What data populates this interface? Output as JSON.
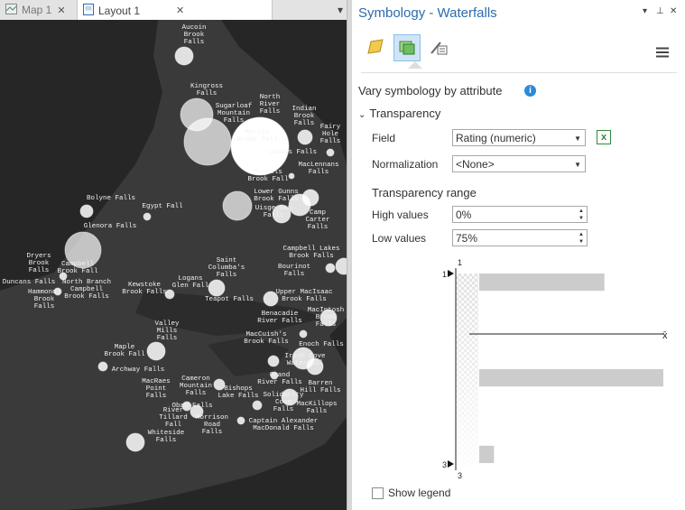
{
  "tabs": [
    {
      "label": "Map 1",
      "icon": "map-icon"
    },
    {
      "label": "Layout 1",
      "icon": "layout-icon"
    }
  ],
  "map": {
    "labels": [
      "Aucoin\nBrook\nFalls",
      "Kingross\nFalls",
      "Sugarloaf\nMountain\nFalls",
      "North\nRiver\nFalls",
      "Indian\nBrook\nFalls",
      "Fairy\nHole\nFalls",
      "Marcia\nBrook Fall",
      "Lisois Falls",
      "MacLennans\nFalls",
      "Mussels\nBrook Fall",
      "Lower Gunns\nBrook Falls",
      "Uisge Ban\nFalls",
      "Camp\nCarter\nFalls",
      "Bolyne Falls",
      "Egypt Fall",
      "Glenora Falls",
      "Campbell Lakes\nBrook Falls",
      "Saint\nColumba's\nFalls",
      "Bourinot\nFalls",
      "Dryers\nBrook\nFalls",
      "Campbell\nBrook Fall",
      "Duncans Falls",
      "North Branch\nCampbell\nBrook Falls",
      "Hammonds\nBrook\nFalls",
      "Kewstoke\nBrook Falls",
      "Logans\nGlen Fall",
      "Teapot Falls",
      "Upper MacIsaac\nBrook Falls",
      "MacIntosh\nBrook\nFalls",
      "Benacadie\nRiver Falls",
      "Valley\nMills\nFalls",
      "MacCuish's\nBrook Falls",
      "Enoch Falls",
      "Maple\nBrook Fall",
      "Irish Cove\nWaterfall",
      "Archway Falls",
      "Cameron\nMountain\nFalls",
      "MacRaes\nPoint\nFalls",
      "Grand\nRiver Falls",
      "Barren\nHill Falls",
      "Bishops\nLake Falls",
      "Solidarity\nCove\nFalls",
      "MacKillops\nFalls",
      "Oban Falls",
      "River\nTillard\nFall",
      "Morrison\nRoad\nFalls",
      "Captain Alexander\nMacDonald Falls",
      "Whiteside\nFalls"
    ]
  },
  "pane": {
    "title": "Symbology - Waterfalls",
    "heading": "Vary symbology by attribute",
    "section": "Transparency",
    "field_label": "Field",
    "field_value": "Rating (numeric)",
    "normalization_label": "Normalization",
    "normalization_value": "<None>",
    "range_heading": "Transparency range",
    "high_label": "High values",
    "high_value": "0%",
    "low_label": "Low values",
    "low_value": "75%",
    "hist_top_tick": "1",
    "hist_bottom_tick": "3",
    "hist_marker_top": "1",
    "hist_marker_bottom": "3",
    "mean_label": "x̄",
    "show_legend": "Show legend"
  },
  "histogram": {
    "bins": [
      0.68,
      0.0,
      0.0,
      0.0,
      0.0,
      1.0,
      0.0,
      0.0,
      0.0,
      0.08
    ],
    "min": 1,
    "max": 3
  },
  "colors": {
    "accent": "#2b6bb0",
    "map_bg": "#262626",
    "land": "#3a3a3a",
    "bar": "#cccccc"
  }
}
